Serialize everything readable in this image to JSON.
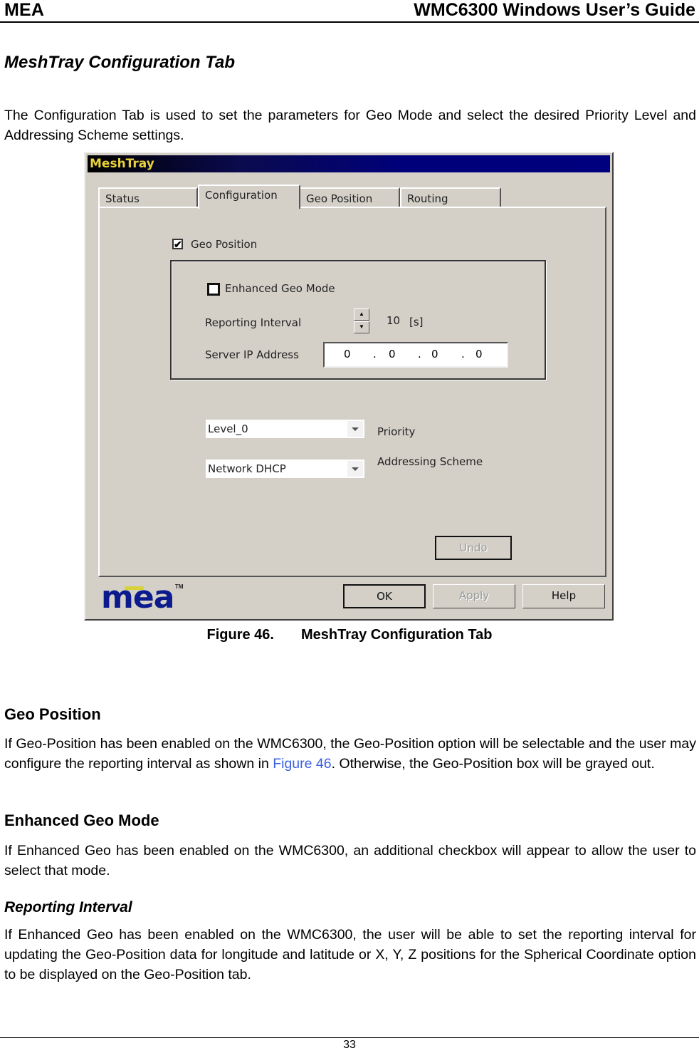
{
  "page_header": {
    "left": "MEA",
    "right": "WMC6300 Windows User’s Guide"
  },
  "section": {
    "title": "MeshTray Configuration Tab",
    "intro": "The Configuration Tab is used to set the parameters for Geo Mode and select the desired Priority Level and Addressing Scheme settings."
  },
  "window": {
    "title": "MeshTray",
    "tabs": [
      {
        "label": "Status",
        "active": false
      },
      {
        "label": "Configuration",
        "active": true
      },
      {
        "label": "Geo Position",
        "active": false
      },
      {
        "label": "Routing",
        "active": false
      }
    ],
    "geo_position_checkbox": {
      "label": "Geo Position",
      "checked": true,
      "mark": "✔"
    },
    "enhanced_geo_checkbox": {
      "label": "Enhanced Geo Mode",
      "checked": false
    },
    "reporting_interval": {
      "label": "Reporting Interval",
      "value": "10",
      "unit": "[s]"
    },
    "server_ip": {
      "label": "Server IP Address",
      "octets": [
        "0",
        "0",
        "0",
        "0"
      ],
      "separator": "."
    },
    "priority": {
      "label": "Priority",
      "selected": "Level_0"
    },
    "addressing_scheme": {
      "label": "Addressing Scheme",
      "selected": "Network DHCP"
    },
    "buttons": {
      "undo": "Undo",
      "ok": "OK",
      "apply": "Apply",
      "help": "Help"
    },
    "logo": {
      "text": "mea",
      "tm": "TM"
    }
  },
  "figure_caption": {
    "number": "Figure 46.",
    "title": "MeshTray Configuration Tab"
  },
  "geo_position": {
    "heading": "Geo Position",
    "text_before_link": "If Geo-Position has been enabled on the WMC6300, the Geo-Position option will be selectable and the user may configure the reporting interval as shown in ",
    "link": "Figure 46",
    "text_after_link": ".  Otherwise, the Geo-Position box will be grayed out."
  },
  "enhanced_geo_mode": {
    "heading": "Enhanced Geo Mode",
    "text": "If Enhanced Geo has been enabled on the WMC6300, an additional checkbox will appear to allow the user to select that mode."
  },
  "reporting_interval_section": {
    "heading": "Reporting Interval",
    "text": "If Enhanced Geo has been enabled on the WMC6300, the user will be able to set the reporting interval for updating the Geo-Position data for longitude and latitude or X, Y, Z positions for the Spherical Coordinate option to be displayed on the Geo-Position tab."
  },
  "page_number": "33",
  "colors": {
    "link": "#3a5fe0",
    "titlebar_text": "#e8d23a",
    "logo_blue": "#0b1a8c",
    "logo_bar": "#d8d23a",
    "dialog_face": "#d4d0c8"
  }
}
